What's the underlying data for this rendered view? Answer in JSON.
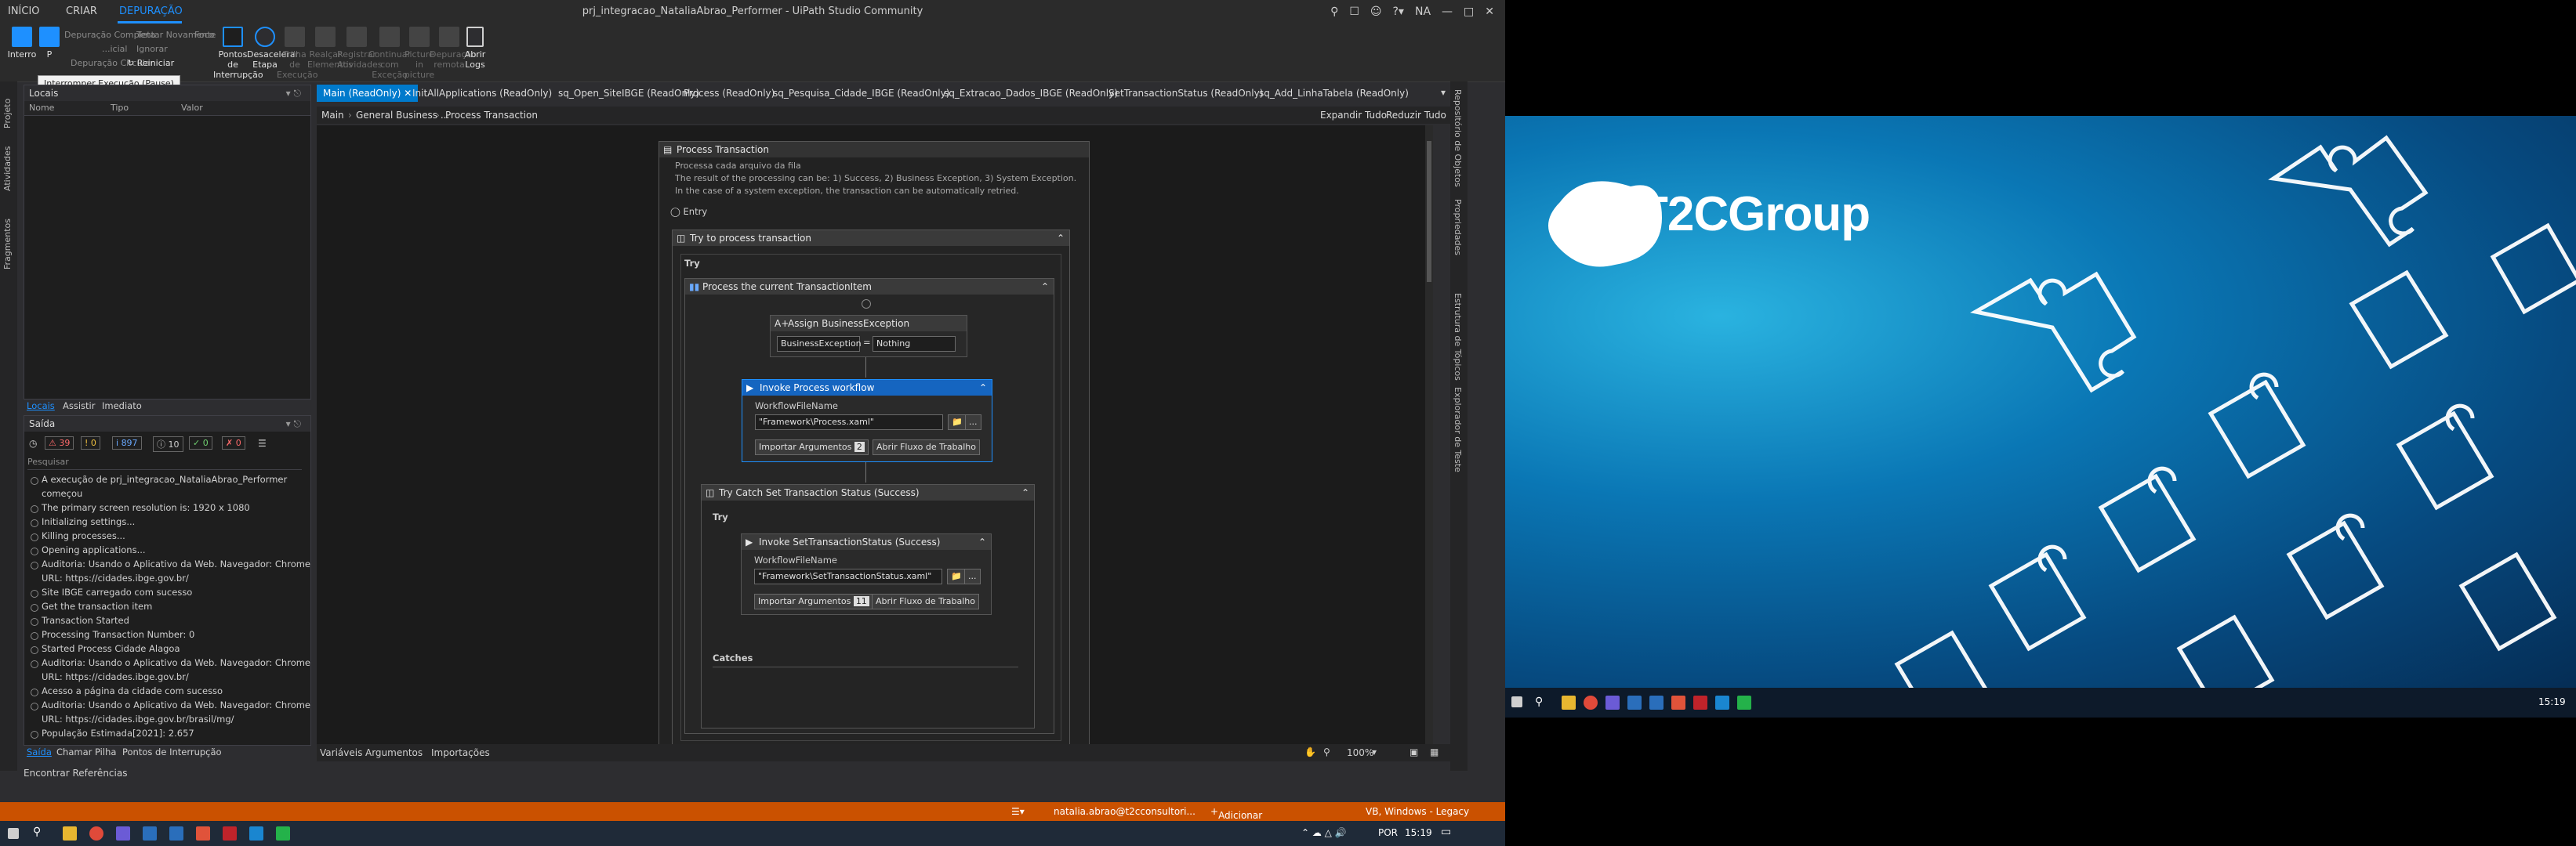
{
  "window": {
    "title": "prj_integracao_NataliaAbrao_Performer - UiPath Studio Community",
    "tabs": [
      "INÍCIO",
      "CRIAR",
      "DEPURAÇÃO"
    ],
    "user_initials": "NA"
  },
  "ribbon": {
    "tooltip": "Interromper Execução (Pause)",
    "interromper": "Interro",
    "parar": "P",
    "depuracao_completa": "Depuração Completa",
    "tentar_novamente": "Tentar Novamente",
    "foco": "Foco",
    "inicial": "...icial",
    "ignorar": "Ignorar",
    "depuracao_circular": "Depuração Circular",
    "reiniciar": "Reiniciar",
    "pontos_interrupcao": "Pontos de Interrupção",
    "desacelerar_etapa": "Desacelerar Etapa",
    "trilha_execucao": "Trilha de Execução",
    "realcar_elementos": "Realçar Elementos",
    "registrar_atividades": "Registrar Atividades",
    "continuar_excecao": "Continuar com Exceção",
    "picture_in_picture": "Picture in picture",
    "depuracao_remota": "Depuração remota",
    "abrir_logs": "Abrir Logs"
  },
  "left_strip": [
    "Projeto",
    "Atividades",
    "Fragmentos"
  ],
  "locals_panel": {
    "title": "Locais",
    "columns": [
      "Nome",
      "Tipo",
      "Valor"
    ],
    "tabs": [
      "Locais",
      "Assistir",
      "Imediato"
    ]
  },
  "output_panel": {
    "title": "Saída",
    "counters": [
      "39",
      "0",
      "897",
      "10",
      "0",
      "0"
    ],
    "search_placeholder": "Pesquisar",
    "lines": [
      "A execução de prj_integracao_NataliaAbrao_Performer",
      "começou",
      "The primary screen resolution is: 1920 x 1080",
      "Initializing settings...",
      "Killing processes...",
      "Opening applications...",
      "Auditoria: Usando o Aplicativo da Web. Navegador: Chrome",
      "URL: https://cidades.ibge.gov.br/",
      "Site IBGE carregado com sucesso",
      "Get the transaction item",
      "Transaction Started",
      "Processing Transaction Number: 0",
      "Started Process Cidade Alagoa",
      "Auditoria: Usando o Aplicativo da Web. Navegador: Chrome",
      "URL: https://cidades.ibge.gov.br/",
      "Acesso a página da cidade com sucesso",
      "Auditoria: Usando o Aplicativo da Web. Navegador: Chrome",
      "URL: https://cidades.ibge.gov.br/brasil/mg/",
      "População Estimada[2021]: 2.657"
    ],
    "bottom_tabs": [
      "Saída",
      "Chamar Pilha",
      "Pontos de Interrupção"
    ]
  },
  "encontrar_referencias": "Encontrar Referências",
  "document_tabs": [
    "Main (ReadOnly)",
    "InitAllApplications (ReadOnly)",
    "sq_Open_SiteIBGE (ReadOnly)",
    "Process (ReadOnly)",
    "sq_Pesquisa_Cidade_IBGE (ReadOnly)",
    "sq_Extracao_Dados_IBGE (ReadOnly)",
    "SetTransactionStatus (ReadOnly)",
    "sq_Add_LinhaTabela (ReadOnly)"
  ],
  "breadcrumb": [
    "Main",
    "General Business ...",
    "Process Transaction"
  ],
  "expand_all": "Expandir Tudo",
  "collapse_all": "Reduzir Tudo",
  "designer": {
    "process_transaction": "Process Transaction",
    "annotation": [
      "Processa cada arquivo da fila",
      "The result of the processing can be: 1) Success, 2) Business Exception, 3) System Exception.",
      "In the case of a system exception, the transaction can be automatically retried."
    ],
    "entry": "Entry",
    "try_process": "Try to process transaction",
    "try_label": "Try",
    "process_current": "Process the current TransactionItem",
    "assign_title": "Assign BusinessException",
    "assign_to": "BusinessException",
    "assign_value": "Nothing",
    "invoke_process": "Invoke Process workflow",
    "workflow_file_name": "WorkflowFileName",
    "process_path": "\"Framework\\Process.xaml\"",
    "importar_argumentos": "Importar Argumentos",
    "process_arg_count": "2",
    "abrir_fluxo": "Abrir Fluxo de Trabalho",
    "try_catch_success": "Try Catch Set Transaction Status (Success)",
    "invoke_set_status": "Invoke SetTransactionStatus (Success)",
    "set_status_path": "\"Framework\\SetTransactionStatus.xaml\"",
    "set_status_arg_count": "11",
    "catches": "Catches",
    "ellipsis": "..."
  },
  "designer_bottom": {
    "tabs": [
      "Variáveis",
      "Argumentos",
      "Importações"
    ],
    "zoom": "100%"
  },
  "right_strip": [
    "Repositório de Objetos",
    "Propriedades",
    "Estrutura de Tópicos",
    "Explorador de Teste"
  ],
  "statusbar": {
    "user": "natalia.abrao@t2cconsultori...",
    "source_control": "Adicionar ao Controle de Or...",
    "language": "VB, Windows - Legacy"
  },
  "taskbar": {
    "language": "POR",
    "time": "15:19"
  },
  "second_monitor": {
    "logo": "T2CGroup",
    "time": "15:19"
  }
}
